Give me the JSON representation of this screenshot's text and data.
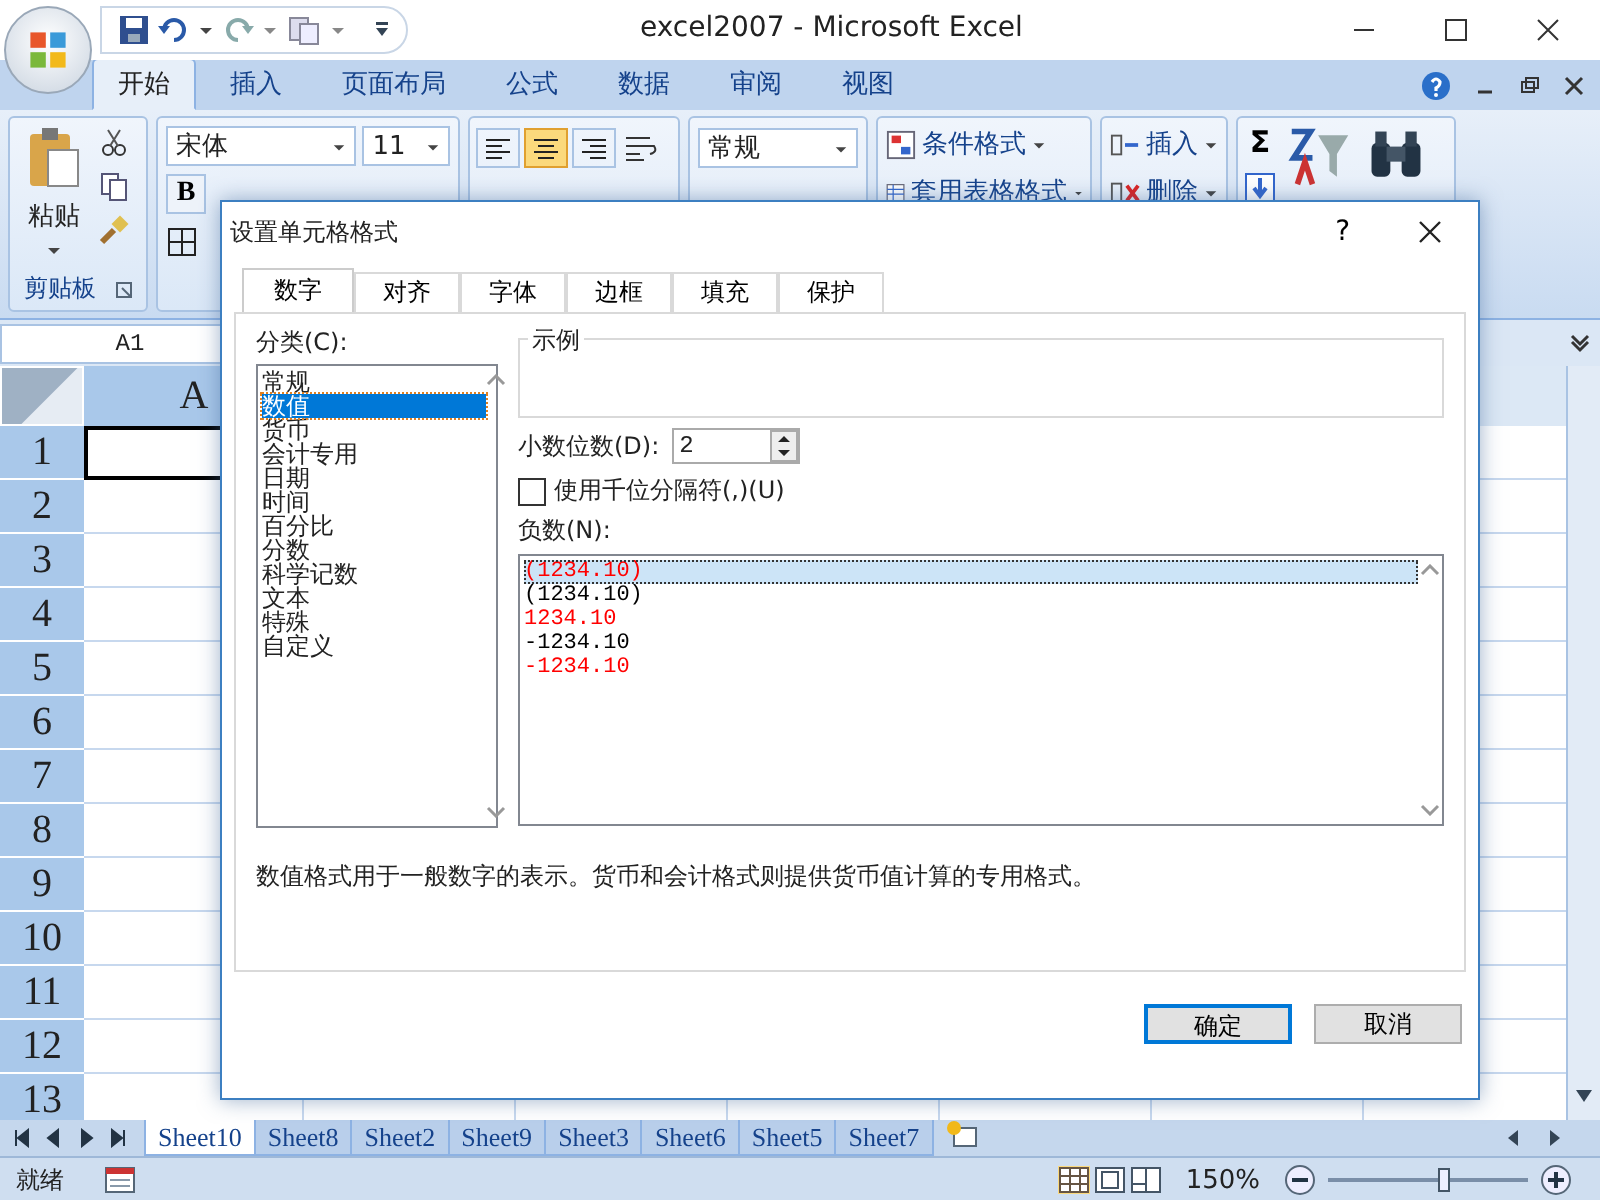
{
  "window": {
    "title": "excel2007 - Microsoft Excel"
  },
  "ribbon_tabs": [
    {
      "label": "开始",
      "selected": true
    },
    {
      "label": "插入",
      "selected": false
    },
    {
      "label": "页面布局",
      "selected": false
    },
    {
      "label": "公式",
      "selected": false
    },
    {
      "label": "数据",
      "selected": false
    },
    {
      "label": "审阅",
      "selected": false
    },
    {
      "label": "视图",
      "selected": false
    }
  ],
  "ribbon": {
    "paste": "粘贴",
    "clipboard_group": "剪贴板",
    "font_name": "宋体",
    "font_size": "11",
    "bold": "B",
    "number_format": "常规",
    "styles": [
      "条件格式",
      "套用表格格式"
    ],
    "cells": [
      "插入",
      "删除"
    ],
    "sum": "Σ"
  },
  "align_buttons": [
    {
      "on": false
    },
    {
      "on": true
    },
    {
      "on": false
    }
  ],
  "name_box": "A1",
  "column_headers": [
    "A"
  ],
  "row_headers": [
    "1",
    "2",
    "3",
    "4",
    "5",
    "6",
    "7",
    "8",
    "9",
    "10",
    "11",
    "12",
    "13"
  ],
  "dialog": {
    "title": "设置单元格格式",
    "help": "?",
    "tabs": [
      {
        "label": "数字",
        "selected": true
      },
      {
        "label": "对齐",
        "selected": false
      },
      {
        "label": "字体",
        "selected": false
      },
      {
        "label": "边框",
        "selected": false
      },
      {
        "label": "填充",
        "selected": false
      },
      {
        "label": "保护",
        "selected": false
      }
    ],
    "category_label": "分类(C):",
    "categories": [
      {
        "label": "常规",
        "selected": false
      },
      {
        "label": "数值",
        "selected": true
      },
      {
        "label": "货币",
        "selected": false
      },
      {
        "label": "会计专用",
        "selected": false
      },
      {
        "label": "日期",
        "selected": false
      },
      {
        "label": "时间",
        "selected": false
      },
      {
        "label": "百分比",
        "selected": false
      },
      {
        "label": "分数",
        "selected": false
      },
      {
        "label": "科学记数",
        "selected": false
      },
      {
        "label": "文本",
        "selected": false
      },
      {
        "label": "特殊",
        "selected": false
      },
      {
        "label": "自定义",
        "selected": false
      }
    ],
    "sample_label": "示例",
    "decimal_label": "小数位数(D):",
    "decimal_value": "2",
    "thousands": {
      "label": "使用千位分隔符(,)(U)",
      "checked": false
    },
    "negative_label": "负数(N):",
    "negatives": [
      {
        "text": "(1234.10)",
        "color": "#ff0000",
        "selected": true
      },
      {
        "text": "(1234.10)",
        "color": "#000000",
        "selected": false
      },
      {
        "text": "1234.10",
        "color": "#ff0000",
        "selected": false
      },
      {
        "text": "-1234.10",
        "color": "#000000",
        "selected": false
      },
      {
        "text": "-1234.10",
        "color": "#ff0000",
        "selected": false
      }
    ],
    "description": "数值格式用于一般数字的表示。货币和会计格式则提供货币值计算的专用格式。",
    "buttons": [
      {
        "label": "确定",
        "default": true
      },
      {
        "label": "取消",
        "default": false
      }
    ]
  },
  "sheet_tabs": [
    {
      "label": "Sheet10",
      "selected": true
    },
    {
      "label": "Sheet8",
      "selected": false
    },
    {
      "label": "Sheet2",
      "selected": false
    },
    {
      "label": "Sheet9",
      "selected": false
    },
    {
      "label": "Sheet3",
      "selected": false
    },
    {
      "label": "Sheet6",
      "selected": false
    },
    {
      "label": "Sheet5",
      "selected": false
    },
    {
      "label": "Sheet7",
      "selected": false
    }
  ],
  "status_bar": {
    "text": "就绪",
    "zoom": "150%",
    "zoom_slider": {
      "level": 0.58
    }
  }
}
